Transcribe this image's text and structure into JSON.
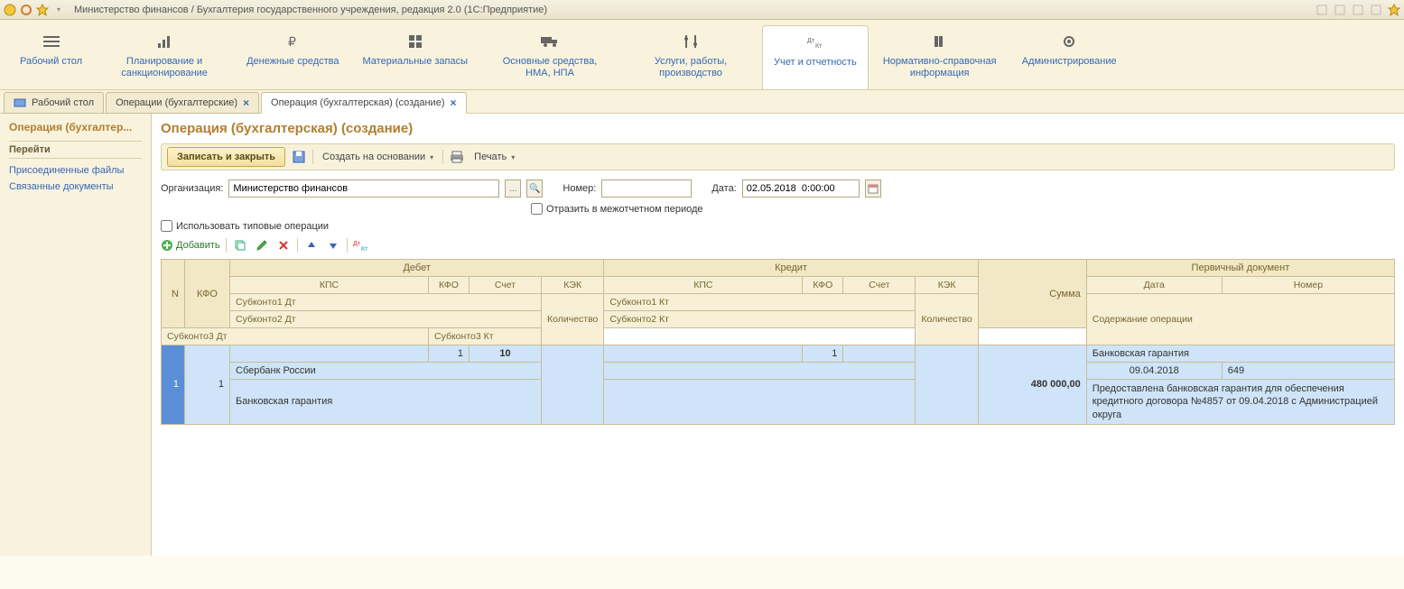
{
  "titlebar": {
    "title": "Министерство финансов / Бухгалтерия государственного учреждения, редакция 2.0  (1С:Предприятие)"
  },
  "nav": [
    {
      "label": "Рабочий стол"
    },
    {
      "label": "Планирование и санкционирование"
    },
    {
      "label": "Денежные средства"
    },
    {
      "label": "Материальные запасы"
    },
    {
      "label": "Основные средства, НМА, НПА"
    },
    {
      "label": "Услуги, работы, производство"
    },
    {
      "label": "Учет и отчетность"
    },
    {
      "label": "Нормативно-справочная информация"
    },
    {
      "label": "Администрирование"
    }
  ],
  "tabs": [
    {
      "label": "Рабочий стол",
      "closable": false
    },
    {
      "label": "Операции (бухгалтерские)",
      "closable": true
    },
    {
      "label": "Операция (бухгалтерская) (создание)",
      "closable": true,
      "active": true
    }
  ],
  "sidebar": {
    "title": "Операция (бухгалтер...",
    "section": "Перейти",
    "links": [
      "Присоединенные файлы",
      "Связанные документы"
    ]
  },
  "page": {
    "title": "Операция (бухгалтерская) (создание)",
    "save_close": "Записать и закрыть",
    "create_based": "Создать на основании",
    "print": "Печать",
    "org_label": "Организация:",
    "org_value": "Министерство финансов",
    "number_label": "Номер:",
    "number_value": "",
    "date_label": "Дата:",
    "date_value": "02.05.2018  0:00:00",
    "interreport": "Отразить в межотчетном периоде",
    "use_typical": "Использовать типовые операции",
    "add": "Добавить"
  },
  "grid": {
    "headers": {
      "n": "N",
      "kfo": "КФО",
      "debit": "Дебет",
      "credit": "Кредит",
      "sum": "Сумма",
      "primary_doc": "Первичный документ",
      "kps": "КПС",
      "kfo2": "КФО",
      "account": "Счет",
      "kek": "КЭК",
      "date": "Дата",
      "number": "Номер",
      "sub1dt": "Субконто1 Дт",
      "sub2dt": "Субконто2 Дт",
      "sub3dt": "Субконто3 Дт",
      "sub1kt": "Субконто1 Кт",
      "sub2kt": "Субконто2 Кт",
      "sub3kt": "Субконто3 Кт",
      "qty": "Количество",
      "content": "Содержание операции"
    },
    "row": {
      "n": "1",
      "kfo": "1",
      "debit_kfo": "1",
      "debit_account": "10",
      "credit_kfo": "1",
      "sum": "480 000,00",
      "doc_title": "Банковская гарантия",
      "doc_date": "09.04.2018",
      "doc_number": "649",
      "sub1dt": "Сбербанк России",
      "sub2dt": "Банковская гарантия",
      "content": "Предоставлена банковская гарантия для обеспечения кредитного договора №4857 от 09.04.2018 с Администрацией округа"
    }
  }
}
